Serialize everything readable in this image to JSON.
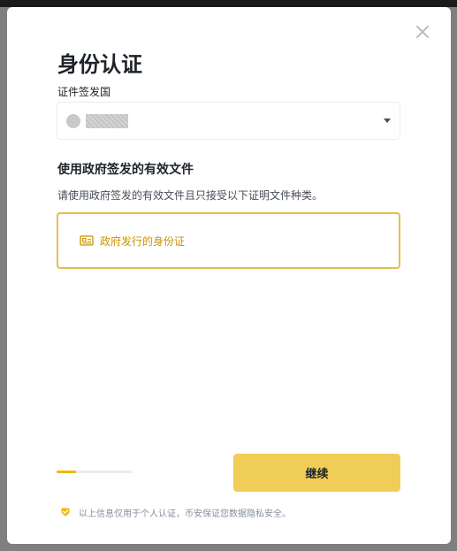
{
  "modal": {
    "title": "身份认证",
    "close_icon": "close-icon",
    "country_field": {
      "label": "证件签发国",
      "selected_value": "",
      "dropdown_icon": "chevron-down-icon"
    },
    "documents_section": {
      "title": "使用政府签发的有效文件",
      "description": "请使用政府签发的有效文件且只接受以下证明文件种类。",
      "options": [
        {
          "label": "政府发行的身份证",
          "icon": "id-card-icon",
          "selected": true
        }
      ]
    },
    "progress": {
      "fraction": 0.25
    },
    "continue_label": "继续",
    "footer_note": "以上信息仅用于个人认证，币安保证您数据隐私安全。",
    "footer_icon": "shield-check-icon"
  },
  "colors": {
    "accent": "#f0b90b",
    "accent_border": "#e5bd4a",
    "accent_text": "#c99400",
    "button_bg": "#f0cd57",
    "text_primary": "#1e2329",
    "text_secondary": "#474d57",
    "text_muted": "#848e9c"
  }
}
